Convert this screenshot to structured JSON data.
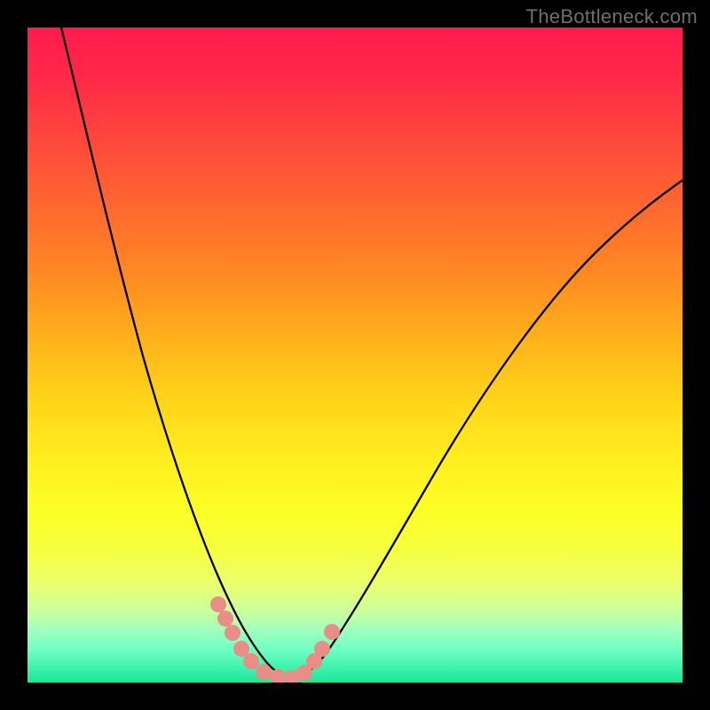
{
  "watermark": "TheBottleneck.com",
  "colors": {
    "background": "#000000",
    "gradient_top": "#ff1a4d",
    "gradient_bottom": "#1fe59b",
    "curve": "#000000",
    "marker": "#e88e87"
  },
  "chart_data": {
    "type": "line",
    "title": "",
    "xlabel": "",
    "ylabel": "",
    "xlim": [
      0,
      100
    ],
    "ylim": [
      0,
      100
    ],
    "series": [
      {
        "name": "left-curve",
        "x": [
          5,
          8,
          11,
          14,
          17,
          20,
          23,
          26,
          28,
          30,
          32,
          34,
          36,
          38
        ],
        "y": [
          100,
          80,
          63,
          48,
          36,
          27,
          20,
          14,
          10,
          8,
          6,
          4,
          2.5,
          1.5
        ]
      },
      {
        "name": "right-curve",
        "x": [
          38,
          42,
          46,
          50,
          55,
          60,
          65,
          70,
          75,
          80,
          85,
          90,
          95,
          100
        ],
        "y": [
          1.5,
          3,
          7,
          13,
          21,
          30,
          38,
          46,
          53,
          59,
          64,
          68,
          71,
          74
        ]
      }
    ],
    "markers": [
      {
        "x": 28.5,
        "y": 10.5
      },
      {
        "x": 29.5,
        "y": 8.5
      },
      {
        "x": 30.5,
        "y": 6.5
      },
      {
        "x": 32,
        "y": 4
      },
      {
        "x": 33.5,
        "y": 2.5
      },
      {
        "x": 35.5,
        "y": 1.8
      },
      {
        "x": 37.5,
        "y": 1.5
      },
      {
        "x": 39.5,
        "y": 2.3
      },
      {
        "x": 41,
        "y": 4
      },
      {
        "x": 42,
        "y": 6
      },
      {
        "x": 43,
        "y": 8
      }
    ],
    "annotations": []
  }
}
